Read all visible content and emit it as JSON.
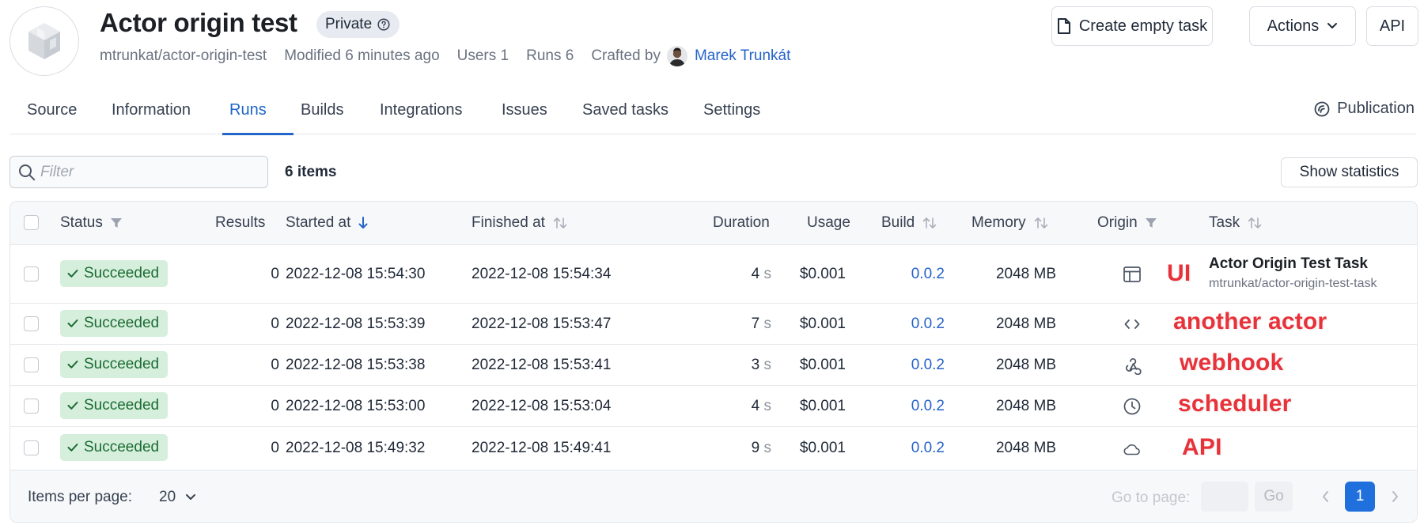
{
  "header": {
    "title": "Actor origin test",
    "visibility_badge": "Private",
    "slug": "mtrunkat/actor-origin-test",
    "modified": "Modified 6 minutes ago",
    "users": "Users 1",
    "runs": "Runs 6",
    "crafted_by_label": "Crafted by",
    "crafter_name": "Marek Trunkát",
    "buttons": {
      "create_empty_task": "Create empty task",
      "actions": "Actions",
      "api": "API"
    }
  },
  "tabs": [
    {
      "label": "Source"
    },
    {
      "label": "Information"
    },
    {
      "label": "Runs",
      "active": true
    },
    {
      "label": "Builds"
    },
    {
      "label": "Integrations"
    },
    {
      "label": "Issues"
    },
    {
      "label": "Saved tasks"
    },
    {
      "label": "Settings"
    }
  ],
  "publication_label": "Publication",
  "filter": {
    "placeholder": "Filter",
    "value": ""
  },
  "items_count": "6 items",
  "show_statistics": "Show statistics",
  "table": {
    "columns": {
      "status": "Status",
      "results": "Results",
      "started_at": "Started at",
      "finished_at": "Finished at",
      "duration": "Duration",
      "usage": "Usage",
      "build": "Build",
      "memory": "Memory",
      "origin": "Origin",
      "task": "Task"
    },
    "rows": [
      {
        "status": "Succeeded",
        "results": "0",
        "started": "2022-12-08 15:54:30",
        "finished": "2022-12-08 15:54:34",
        "duration": "4",
        "duration_unit": "s",
        "usage": "$0.001",
        "build": "0.0.2",
        "memory": "2048 MB",
        "origin_icon": "browser-window-icon",
        "annotation": "UI",
        "task_title": "Actor Origin Test Task",
        "task_slug": "mtrunkat/actor-origin-test-task"
      },
      {
        "status": "Succeeded",
        "results": "0",
        "started": "2022-12-08 15:53:39",
        "finished": "2022-12-08 15:53:47",
        "duration": "7",
        "duration_unit": "s",
        "usage": "$0.001",
        "build": "0.0.2",
        "memory": "2048 MB",
        "origin_icon": "code-brackets-icon",
        "annotation": "another actor"
      },
      {
        "status": "Succeeded",
        "results": "0",
        "started": "2022-12-08 15:53:38",
        "finished": "2022-12-08 15:53:41",
        "duration": "3",
        "duration_unit": "s",
        "usage": "$0.001",
        "build": "0.0.2",
        "memory": "2048 MB",
        "origin_icon": "webhook-icon",
        "annotation": "webhook"
      },
      {
        "status": "Succeeded",
        "results": "0",
        "started": "2022-12-08 15:53:00",
        "finished": "2022-12-08 15:53:04",
        "duration": "4",
        "duration_unit": "s",
        "usage": "$0.001",
        "build": "0.0.2",
        "memory": "2048 MB",
        "origin_icon": "clock-icon",
        "annotation": "scheduler"
      },
      {
        "status": "Succeeded",
        "results": "0",
        "started": "2022-12-08 15:49:32",
        "finished": "2022-12-08 15:49:41",
        "duration": "9",
        "duration_unit": "s",
        "usage": "$0.001",
        "build": "0.0.2",
        "memory": "2048 MB",
        "origin_icon": "cloud-icon",
        "annotation": "API"
      }
    ]
  },
  "footer": {
    "items_per_page_label": "Items per page:",
    "items_per_page_value": "20",
    "goto_label": "Go to page:",
    "go_button": "Go",
    "current_page": "1"
  },
  "colors": {
    "accent": "#2466c8",
    "success_bg": "#d6efdc",
    "success_text": "#1b6b33",
    "annotation": "#e8323a"
  }
}
